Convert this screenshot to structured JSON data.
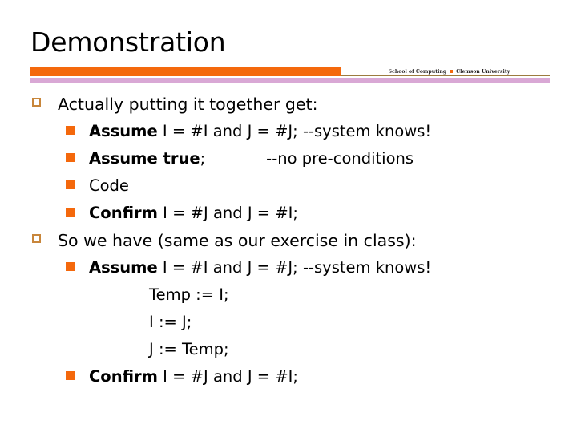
{
  "slide": {
    "title": "Demonstration",
    "header": {
      "school": "School of Computing",
      "separator_icon": "square-bullet-icon",
      "university": "Clemson University"
    },
    "colors": {
      "orange": "#f4680c",
      "lilac": "#d9a8d5",
      "rule": "#9c7b3f",
      "hollow_bullet_border": "#c8863b",
      "text": "#000000"
    },
    "content": [
      {
        "level": 1,
        "bullet": "hollow-square",
        "text": "Actually putting it together get:"
      },
      {
        "level": 2,
        "bullet": "solid-square",
        "keyword": "Assume",
        "text": " I = #I and J = #J; --system knows!"
      },
      {
        "level": 2,
        "bullet": "solid-square",
        "keyword": "Assume true",
        "text": ";",
        "text2": "--no pre-conditions"
      },
      {
        "level": 2,
        "bullet": "solid-square",
        "text": "Code"
      },
      {
        "level": 2,
        "bullet": "solid-square",
        "keyword": "Confirm",
        "text": " I = #J and J = #I;"
      },
      {
        "level": 1,
        "bullet": "hollow-square",
        "text": "So we have (same as our exercise in class):"
      },
      {
        "level": 2,
        "bullet": "solid-square",
        "keyword": "Assume",
        "text": " I = #I and J = #J; --system knows!"
      },
      {
        "level": 3,
        "bullet": "none",
        "text": "Temp := I;"
      },
      {
        "level": 3,
        "bullet": "none",
        "text": "I := J;"
      },
      {
        "level": 3,
        "bullet": "none",
        "text": "J := Temp;"
      },
      {
        "level": 2,
        "bullet": "solid-square",
        "keyword": "Confirm",
        "text": " I = #J and J = #I;"
      }
    ]
  }
}
